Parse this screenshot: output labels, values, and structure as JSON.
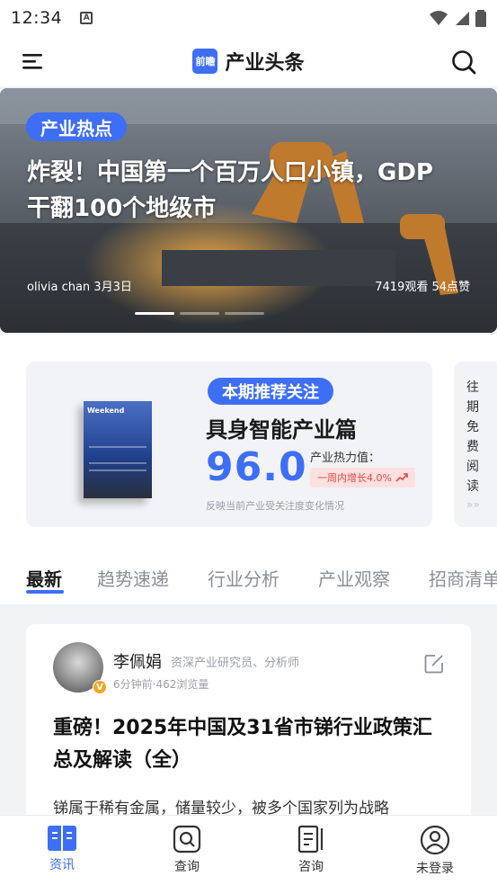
{
  "status_bar": {
    "time": "12:34"
  },
  "header": {
    "brand_logo_text": "前瞻",
    "title": "产业头条"
  },
  "banner": {
    "tag": "产业热点",
    "headline": "炸裂！中国第一个百万人口小镇，GDP干翻100个地级市",
    "author_date": "olivia chan 3月3日",
    "stats": "7419观看 54点赞",
    "slide_count": 3,
    "active_slide": 0
  },
  "featured": {
    "tag": "本期推荐关注",
    "title": "具身智能产业篇",
    "score": "96.0",
    "heat_label": "产业热力值：",
    "heat_change": "一周内增长4.0%",
    "subtitle": "反映当前产业受关注度变化情况",
    "book_cover_text": "Weekend",
    "side_label": "往期免费阅读"
  },
  "tabs": [
    "最新",
    "趋势速递",
    "行业分析",
    "产业观察",
    "招商清单"
  ],
  "active_tab": 0,
  "article": {
    "author": "李佩娟",
    "role": "资深产业研究员、分析师",
    "meta": "6分钟前·462浏览量",
    "title": "重磅！2025年中国及31省市锑行业政策汇总及解读（全）",
    "body": "锑属于稀有金属，储量较少，被多个国家列为战略"
  },
  "bottom_nav": [
    {
      "label": "资讯",
      "icon": "news-icon",
      "active": true
    },
    {
      "label": "查询",
      "icon": "query-icon",
      "active": false
    },
    {
      "label": "咨询",
      "icon": "consult-icon",
      "active": false
    },
    {
      "label": "未登录",
      "icon": "user-icon",
      "active": false
    }
  ],
  "colors": {
    "accent": "#3d6ef5",
    "heat_red": "#e04a44"
  }
}
